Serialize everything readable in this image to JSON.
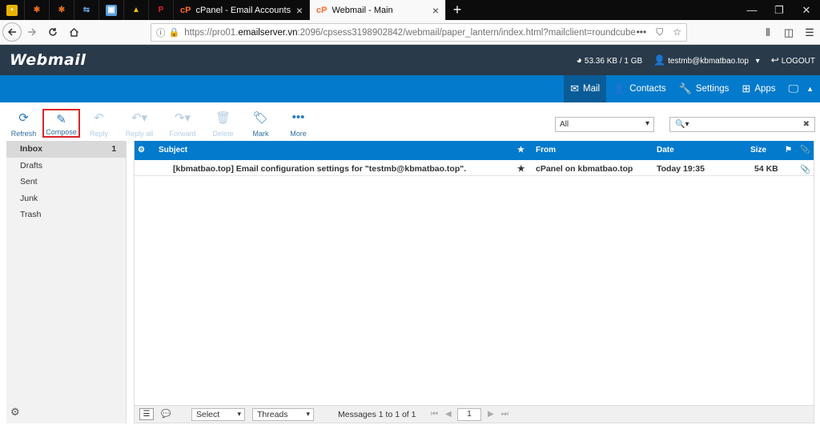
{
  "browser": {
    "tabs": [
      {
        "title": "cPanel - Email Accounts",
        "icon": "cpanel-icon",
        "active": false
      },
      {
        "title": "Webmail - Main",
        "icon": "cpanel-icon",
        "active": true
      }
    ],
    "tab_close": "×",
    "new_tab": "+",
    "url": {
      "prefix": "https://pro01.",
      "host": "emailserver.vn",
      "rest": ":2096/cpsess3198902842/webmail/paper_lantern/index.html?mailclient=roundcube",
      "more": "•••"
    }
  },
  "header": {
    "logo": "Webmail",
    "quota": "53.36 KB / 1 GB",
    "user": "testmb@kbmatbao.top",
    "logout": "LOGOUT"
  },
  "menu": {
    "mail": "Mail",
    "contacts": "Contacts",
    "settings": "Settings",
    "apps": "Apps"
  },
  "toolbar": {
    "refresh": "Refresh",
    "compose": "Compose",
    "reply": "Reply",
    "reply_all": "Reply all",
    "forward": "Forward",
    "delete": "Delete",
    "mark": "Mark",
    "more": "More"
  },
  "filter": {
    "selected": "All"
  },
  "search": {
    "placeholder": ""
  },
  "folders": [
    {
      "name": "Inbox",
      "count": "1"
    },
    {
      "name": "Drafts",
      "count": ""
    },
    {
      "name": "Sent",
      "count": ""
    },
    {
      "name": "Junk",
      "count": ""
    },
    {
      "name": "Trash",
      "count": ""
    }
  ],
  "list": {
    "columns": {
      "subject": "Subject",
      "from": "From",
      "date": "Date",
      "size": "Size"
    },
    "rows": [
      {
        "subject": "[kbmatbao.top] Email configuration settings for \"testmb@kbmatbao.top\".",
        "from": "cPanel on kbmatbao.top",
        "date": "Today 19:35",
        "size": "54 KB"
      }
    ]
  },
  "footer": {
    "select": "Select",
    "threads": "Threads",
    "count_text": "Messages 1 to 1 of 1",
    "page": "1"
  },
  "colors": {
    "header_bg": "#293a4a",
    "menu_bg": "#037acc",
    "accent": "#2a78bb",
    "highlight_border": "#d9262b"
  }
}
